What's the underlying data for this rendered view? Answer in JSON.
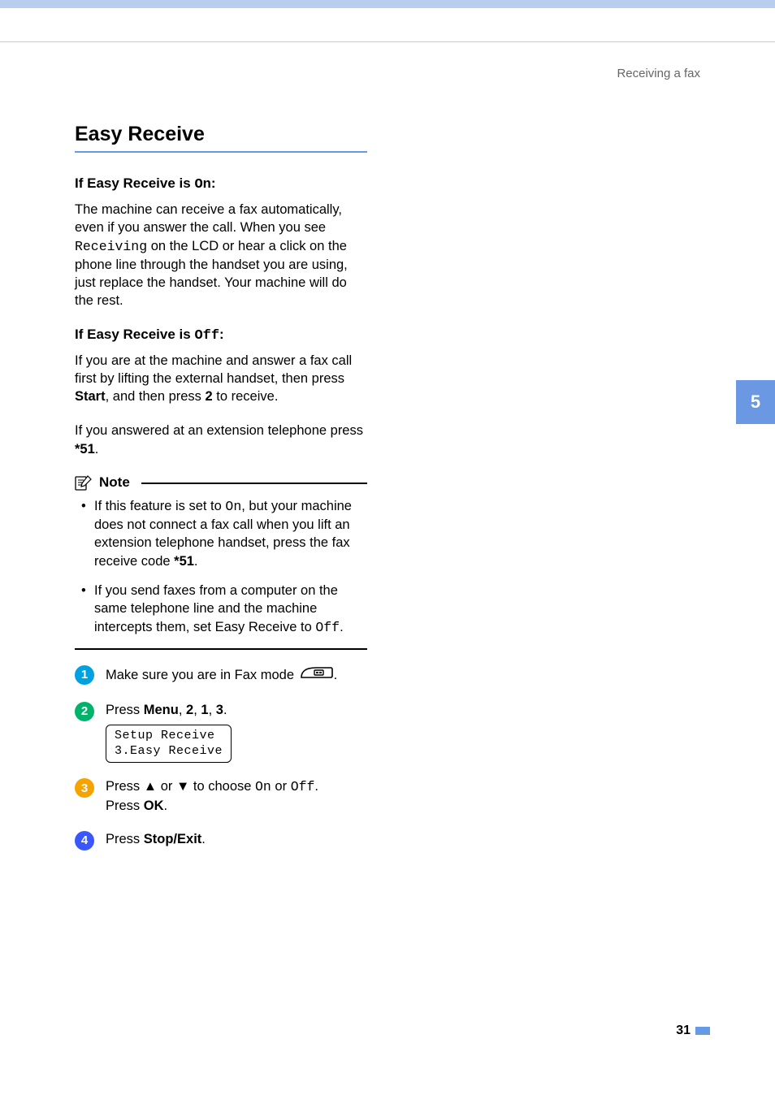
{
  "header": {
    "breadcrumb": "Receiving a fax"
  },
  "section": {
    "title": "Easy Receive"
  },
  "on_block": {
    "heading_prefix": "If Easy Receive is ",
    "heading_mono": "On",
    "heading_suffix": ":",
    "para_a": "The machine can receive a fax automatically, even if you answer the call. When you see ",
    "para_mono": "Receiving",
    "para_b": " on the LCD or hear a click on the phone line through the handset you are using, just replace the handset. Your machine will do the rest."
  },
  "off_block": {
    "heading_prefix": "If Easy Receive is ",
    "heading_mono": "Off",
    "heading_suffix": ":",
    "para1_a": "If you are at the machine and answer a fax call first by lifting the external handset, then press ",
    "para1_b": "Start",
    "para1_c": ", and then press ",
    "para1_d": "2",
    "para1_e": " to receive.",
    "para2_a": "If you answered at an extension telephone press ",
    "para2_code": "*",
    "para2_b": "51",
    "para2_c": "."
  },
  "note": {
    "label": "Note",
    "item1_a": "If this feature is set to ",
    "item1_mono": "On",
    "item1_b": ", but your machine does not connect a fax call when you lift an extension telephone handset, press the fax receive code ",
    "item1_code": "*",
    "item1_c": "51",
    "item1_d": ".",
    "item2_a": "If you send faxes from a computer on the same telephone line and the machine intercepts them, set Easy Receive to ",
    "item2_mono": "Off",
    "item2_b": "."
  },
  "steps": {
    "s1": {
      "num": "1",
      "text": "Make sure you are in Fax mode ",
      "period": "."
    },
    "s2": {
      "num": "2",
      "a": "Press ",
      "menu": "Menu",
      "b": ", ",
      "k1": "2",
      "c": ", ",
      "k2": "1",
      "d": ", ",
      "k3": "3",
      "e": ".",
      "lcd": "Setup Receive\n3.Easy Receive"
    },
    "s3": {
      "num": "3",
      "a": "Press ",
      "up": "▲",
      "b": " or ",
      "down": "▼",
      "c": " to choose ",
      "on": "On",
      "d": " or ",
      "off": "Off",
      "e": ".",
      "line2a": "Press ",
      "ok": "OK",
      "line2b": "."
    },
    "s4": {
      "num": "4",
      "a": "Press ",
      "stop": "Stop/Exit",
      "b": "."
    }
  },
  "sidetab": {
    "label": "5"
  },
  "footer": {
    "page": "31"
  }
}
